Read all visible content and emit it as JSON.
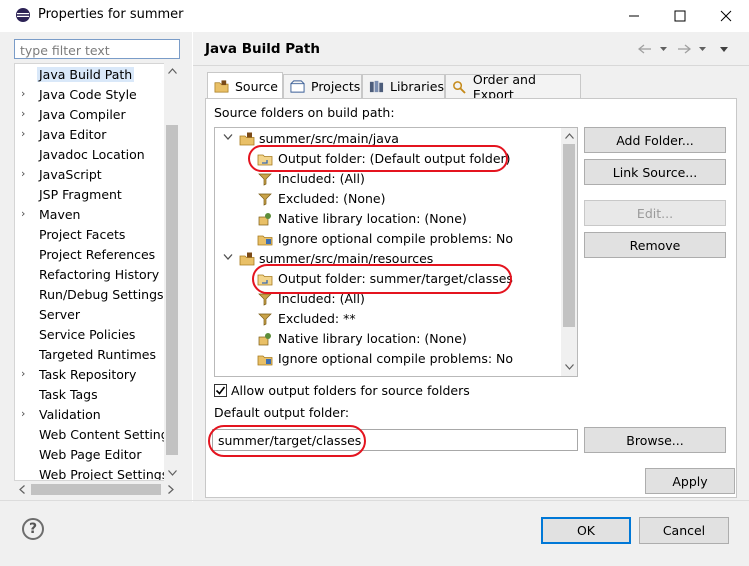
{
  "window": {
    "title": "Properties for summer"
  },
  "filter": {
    "placeholder": "type filter text"
  },
  "nav": {
    "items": [
      {
        "label": "Java Build Path",
        "arrow": "",
        "selected": true
      },
      {
        "label": "Java Code Style",
        "arrow": "›"
      },
      {
        "label": "Java Compiler",
        "arrow": "›"
      },
      {
        "label": "Java Editor",
        "arrow": "›"
      },
      {
        "label": "Javadoc Location",
        "arrow": ""
      },
      {
        "label": "JavaScript",
        "arrow": "›"
      },
      {
        "label": "JSP Fragment",
        "arrow": ""
      },
      {
        "label": "Maven",
        "arrow": "›"
      },
      {
        "label": "Project Facets",
        "arrow": ""
      },
      {
        "label": "Project References",
        "arrow": ""
      },
      {
        "label": "Refactoring History",
        "arrow": ""
      },
      {
        "label": "Run/Debug Settings",
        "arrow": ""
      },
      {
        "label": "Server",
        "arrow": ""
      },
      {
        "label": "Service Policies",
        "arrow": ""
      },
      {
        "label": "Targeted Runtimes",
        "arrow": ""
      },
      {
        "label": "Task Repository",
        "arrow": "›"
      },
      {
        "label": "Task Tags",
        "arrow": ""
      },
      {
        "label": "Validation",
        "arrow": "›"
      },
      {
        "label": "Web Content Settings",
        "arrow": ""
      },
      {
        "label": "Web Page Editor",
        "arrow": ""
      },
      {
        "label": "Web Project Settings",
        "arrow": ""
      }
    ]
  },
  "page": {
    "title": "Java Build Path"
  },
  "tabs": [
    {
      "label": "Source"
    },
    {
      "label": "Projects"
    },
    {
      "label": "Libraries"
    },
    {
      "label": "Order and Export"
    }
  ],
  "source": {
    "heading": "Source folders on build path:",
    "tree": [
      {
        "text": "summer/src/main/java",
        "type": "folder"
      },
      {
        "text": "Output folder: (Default output folder)",
        "type": "output"
      },
      {
        "text": "Included: (All)",
        "type": "filter"
      },
      {
        "text": "Excluded: (None)",
        "type": "filter"
      },
      {
        "text": "Native library location: (None)",
        "type": "native"
      },
      {
        "text": "Ignore optional compile problems: No",
        "type": "warn"
      },
      {
        "text": "summer/src/main/resources",
        "type": "folder"
      },
      {
        "text": "Output folder: summer/target/classes",
        "type": "output"
      },
      {
        "text": "Included: (All)",
        "type": "filter"
      },
      {
        "text": "Excluded: **",
        "type": "filter"
      },
      {
        "text": "Native library location: (None)",
        "type": "native"
      },
      {
        "text": "Ignore optional compile problems: No",
        "type": "warn"
      }
    ],
    "buttons": {
      "add_folder": "Add Folder...",
      "link_source": "Link Source...",
      "edit": "Edit...",
      "remove": "Remove"
    },
    "allow_output_label": "Allow output folders for source folders",
    "allow_output_checked": true,
    "default_output_label": "Default output folder:",
    "default_output_value": "summer/target/classes",
    "browse": "Browse..."
  },
  "footer": {
    "apply": "Apply",
    "ok": "OK",
    "cancel": "Cancel",
    "help_symbol": "?"
  },
  "colors": {
    "annotation": "#e4141f",
    "selection": "#d9e8f9",
    "accent": "#0078d7"
  }
}
